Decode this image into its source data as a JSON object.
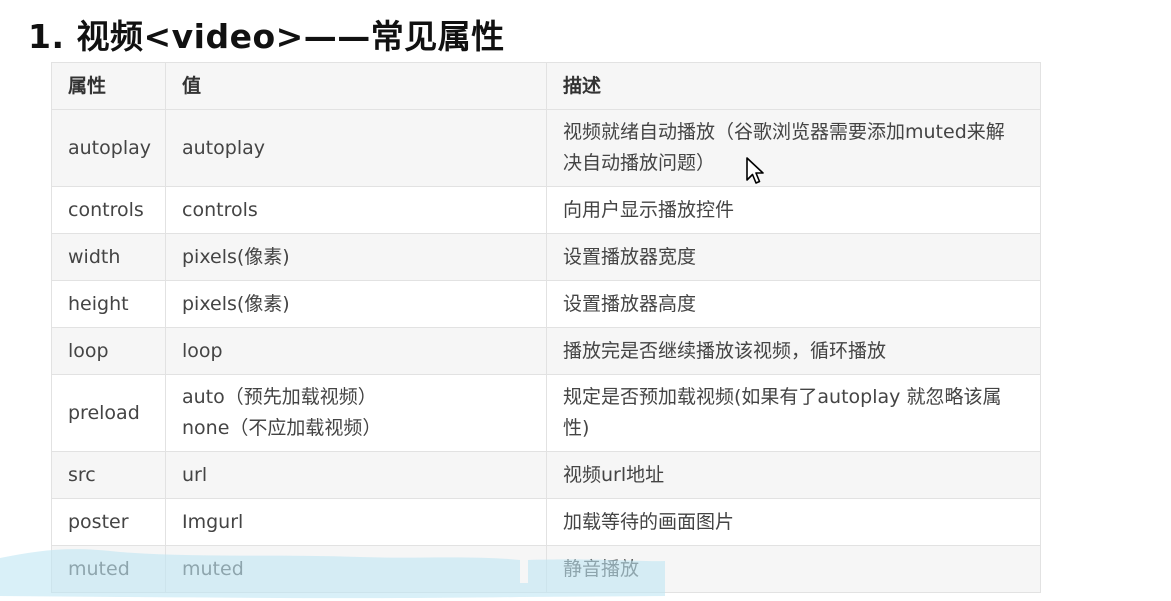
{
  "title": "1. 视频<video>——常见属性",
  "table": {
    "headers": [
      "属性",
      "值",
      "描述"
    ],
    "rows": [
      {
        "attr": "autoplay",
        "value": [
          "autoplay"
        ],
        "desc": [
          "视频就绪自动播放（谷歌浏览器需要添加muted来解",
          "决自动播放问题）"
        ]
      },
      {
        "attr": "controls",
        "value": [
          "controls"
        ],
        "desc": [
          "向用户显示播放控件"
        ]
      },
      {
        "attr": "width",
        "value": [
          "pixels(像素)"
        ],
        "desc": [
          "设置播放器宽度"
        ]
      },
      {
        "attr": "height",
        "value": [
          "pixels(像素)"
        ],
        "desc": [
          "设置播放器高度"
        ]
      },
      {
        "attr": "loop",
        "value": [
          "loop"
        ],
        "desc": [
          "播放完是否继续播放该视频，循环播放"
        ]
      },
      {
        "attr": "preload",
        "value": [
          "auto（预先加载视频）",
          "none（不应加载视频）"
        ],
        "desc": [
          "规定是否预加载视频(如果有了autoplay  就忽略该属",
          "性)"
        ]
      },
      {
        "attr": "src",
        "value": [
          "url"
        ],
        "desc": [
          "视频url地址"
        ]
      },
      {
        "attr": "poster",
        "value": [
          "Imgurl"
        ],
        "desc": [
          "加载等待的画面图片"
        ]
      },
      {
        "attr": "muted",
        "value": [
          "muted"
        ],
        "desc": [
          "静音播放"
        ]
      }
    ]
  },
  "colors": {
    "row_stripe": "#f6f6f6",
    "border": "#e2e2e2",
    "highlight_wash": "#bfe6f3"
  },
  "icons": [
    "mouse-pointer-icon"
  ]
}
